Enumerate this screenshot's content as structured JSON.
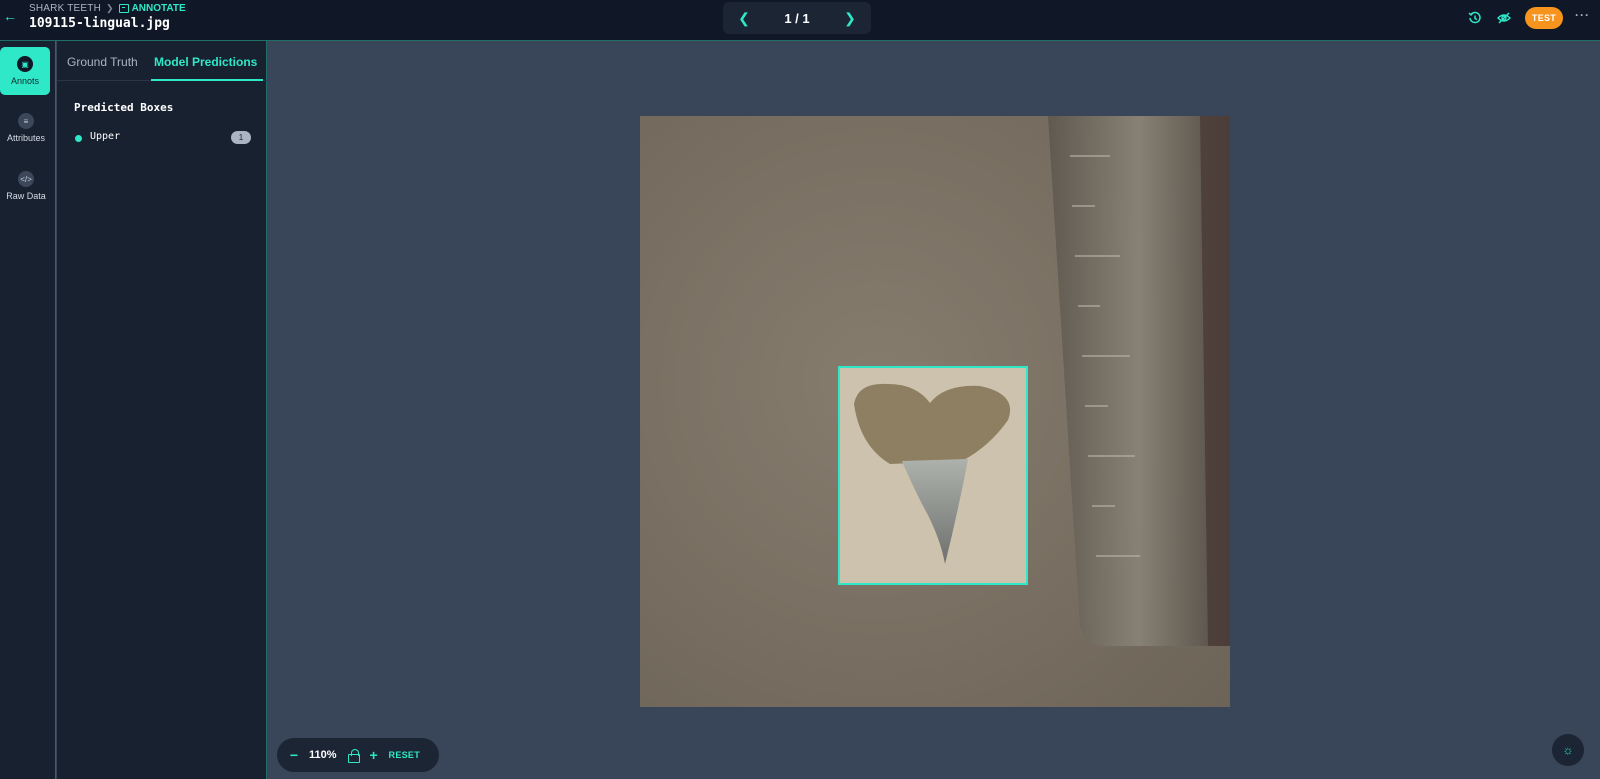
{
  "header": {
    "breadcrumb_project": "SHARK TEETH",
    "breadcrumb_mode": "ANNOTATE",
    "filename": "109115-lingual.jpg",
    "pager_label": "1 / 1",
    "user_badge": "TEST",
    "icons": [
      "back-arrow-icon",
      "chevron-right-icon",
      "annotate-icon",
      "chevron-left-icon",
      "chevron-right-icon",
      "history-icon",
      "eye-off-icon",
      "more-icon"
    ]
  },
  "rail": {
    "items": [
      {
        "label": "Annots",
        "icon": "annotation-icon",
        "active": true
      },
      {
        "label": "Attributes",
        "icon": "list-icon",
        "active": false
      },
      {
        "label": "Raw Data",
        "icon": "code-icon",
        "active": false
      }
    ]
  },
  "panel": {
    "tabs": [
      {
        "label": "Ground Truth",
        "active": false
      },
      {
        "label": "Model Predictions",
        "active": true
      }
    ],
    "section_title": "Predicted Boxes",
    "predictions": [
      {
        "label": "Upper",
        "count": "1",
        "color": "#2ee8c8"
      }
    ]
  },
  "canvas": {
    "zoom_level": "110%",
    "reset_label": "RESET",
    "image_alt": "shark tooth on stone with ruler",
    "box_label": "Upper"
  },
  "colors": {
    "accent": "#2ee8c8",
    "header_bg": "#101828",
    "panel_bg": "#172130",
    "canvas_bg": "#394559",
    "badge": "#f7941d"
  }
}
